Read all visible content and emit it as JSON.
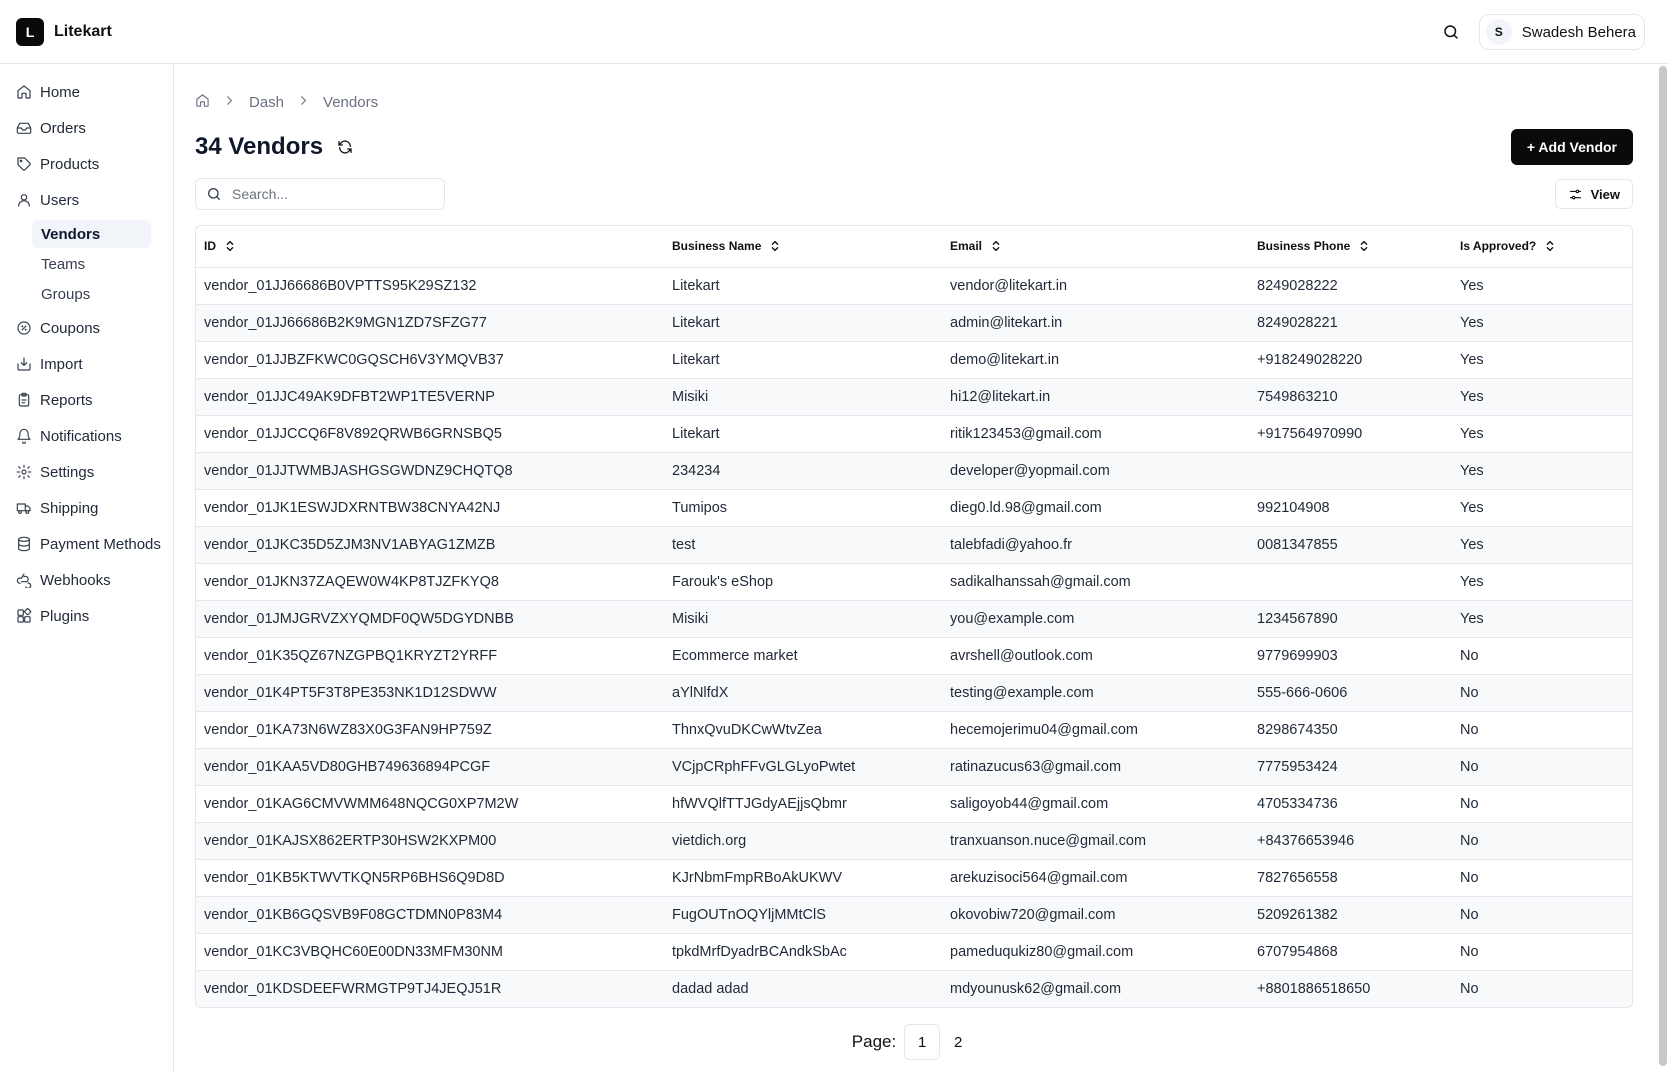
{
  "app": {
    "logo_letter": "L",
    "name": "Litekart"
  },
  "header": {
    "user_initial": "S",
    "user_name": "Swadesh Behera"
  },
  "sidebar": {
    "items": [
      {
        "label": "Home",
        "icon": "home-icon"
      },
      {
        "label": "Orders",
        "icon": "inbox-icon"
      },
      {
        "label": "Products",
        "icon": "tag-icon"
      },
      {
        "label": "Users",
        "icon": "user-icon"
      },
      {
        "label": "Coupons",
        "icon": "badge-percent-icon"
      },
      {
        "label": "Import",
        "icon": "import-icon"
      },
      {
        "label": "Reports",
        "icon": "clipboard-icon"
      },
      {
        "label": "Notifications",
        "icon": "bell-icon"
      },
      {
        "label": "Settings",
        "icon": "gear-icon"
      },
      {
        "label": "Shipping",
        "icon": "truck-icon"
      },
      {
        "label": "Payment Methods",
        "icon": "database-icon"
      },
      {
        "label": "Webhooks",
        "icon": "webhook-icon"
      },
      {
        "label": "Plugins",
        "icon": "plugins-icon"
      }
    ],
    "users_sub": [
      {
        "label": "Vendors",
        "active": true
      },
      {
        "label": "Teams",
        "active": false
      },
      {
        "label": "Groups",
        "active": false
      }
    ]
  },
  "breadcrumb": {
    "items": [
      "Dash",
      "Vendors"
    ]
  },
  "page": {
    "title": "34 Vendors",
    "add_button": "+ Add Vendor"
  },
  "search": {
    "placeholder": "Search..."
  },
  "view_button": "View",
  "table": {
    "columns": [
      "ID",
      "Business Name",
      "Email",
      "Business Phone",
      "Is Approved?"
    ],
    "rows": [
      [
        "vendor_01JJ66686B0VPTTS95K29SZ132",
        "Litekart",
        "vendor@litekart.in",
        "8249028222",
        "Yes"
      ],
      [
        "vendor_01JJ66686B2K9MGN1ZD7SFZG77",
        "Litekart",
        "admin@litekart.in",
        "8249028221",
        "Yes"
      ],
      [
        "vendor_01JJBZFKWC0GQSCH6V3YMQVB37",
        "Litekart",
        "demo@litekart.in",
        "+918249028220",
        "Yes"
      ],
      [
        "vendor_01JJC49AK9DFBT2WP1TE5VERNP",
        "Misiki",
        "hi12@litekart.in",
        "7549863210",
        "Yes"
      ],
      [
        "vendor_01JJCCQ6F8V892QRWB6GRNSBQ5",
        "Litekart",
        "ritik123453@gmail.com",
        "+917564970990",
        "Yes"
      ],
      [
        "vendor_01JJTWMBJASHGSGWDNZ9CHQTQ8",
        "234234",
        "developer@yopmail.com",
        "",
        "Yes"
      ],
      [
        "vendor_01JK1ESWJDXRNTBW38CNYA42NJ",
        "Tumipos",
        "dieg0.ld.98@gmail.com",
        "992104908",
        "Yes"
      ],
      [
        "vendor_01JKC35D5ZJM3NV1ABYAG1ZMZB",
        "test",
        "talebfadi@yahoo.fr",
        "0081347855",
        "Yes"
      ],
      [
        "vendor_01JKN37ZAQEW0W4KP8TJZFKYQ8",
        "Farouk's eShop",
        "sadikalhanssah@gmail.com",
        "",
        "Yes"
      ],
      [
        "vendor_01JMJGRVZXYQMDF0QW5DGYDNBB",
        "Misiki",
        "you@example.com",
        "1234567890",
        "Yes"
      ],
      [
        "vendor_01K35QZ67NZGPBQ1KRYZT2YRFF",
        "Ecommerce market",
        "avrshell@outlook.com",
        "9779699903",
        "No"
      ],
      [
        "vendor_01K4PT5F3T8PE353NK1D12SDWW",
        "aYlNlfdX",
        "testing@example.com",
        "555-666-0606",
        "No"
      ],
      [
        "vendor_01KA73N6WZ83X0G3FAN9HP759Z",
        "ThnxQvuDKCwWtvZea",
        "hecemojerimu04@gmail.com",
        "8298674350",
        "No"
      ],
      [
        "vendor_01KAA5VD80GHB749636894PCGF",
        "VCjpCRphFFvGLGLyoPwtet",
        "ratinazucus63@gmail.com",
        "7775953424",
        "No"
      ],
      [
        "vendor_01KAG6CMVWMM648NQCG0XP7M2W",
        "hfWVQlfTTJGdyAEjjsQbmr",
        "saligoyob44@gmail.com",
        "4705334736",
        "No"
      ],
      [
        "vendor_01KAJSX862ERTP30HSW2KXPM00",
        "vietdich.org",
        "tranxuanson.nuce@gmail.com",
        "+84376653946",
        "No"
      ],
      [
        "vendor_01KB5KTWVTKQN5RP6BHS6Q9D8D",
        "KJrNbmFmpRBoAkUKWV",
        "arekuzisoci564@gmail.com",
        "7827656558",
        "No"
      ],
      [
        "vendor_01KB6GQSVB9F08GCTDMN0P83M4",
        "FugOUTnOQYljMMtClS",
        "okovobiw720@gmail.com",
        "5209261382",
        "No"
      ],
      [
        "vendor_01KC3VBQHC60E00DN33MFM30NM",
        "tpkdMrfDyadrBCAndkSbAc",
        "pameduqukiz80@gmail.com",
        "6707954868",
        "No"
      ],
      [
        "vendor_01KDSDEEFWRMGTP9TJ4JEQJ51R",
        "dadad adad",
        "mdyounusk62@gmail.com",
        "+8801886518650",
        "No"
      ]
    ]
  },
  "pagination": {
    "label": "Page:",
    "pages": [
      "1",
      "2"
    ],
    "current": "1"
  }
}
